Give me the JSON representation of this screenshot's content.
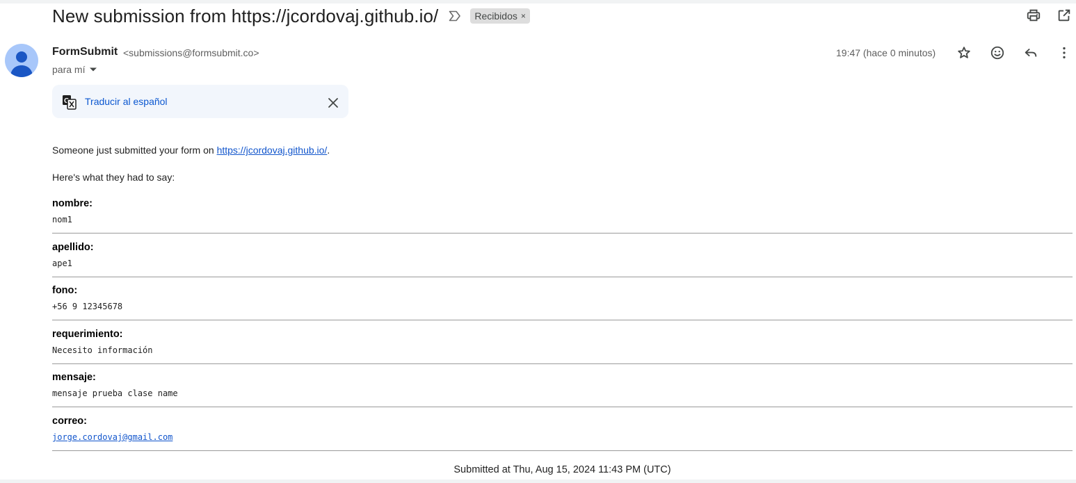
{
  "email": {
    "subject": "New submission from https://jcordovaj.github.io/",
    "label": "Recibidos",
    "label_remove": "×",
    "sender_name": "FormSubmit",
    "sender_email": "<submissions@formsubmit.co>",
    "recipient": "para mí",
    "timestamp": "19:47 (hace 0 minutos)"
  },
  "translate": {
    "link_text": "Traducir al español"
  },
  "body": {
    "intro_prefix": "Someone just submitted your form on ",
    "intro_link": "https://jcordovaj.github.io/",
    "intro_suffix": ".",
    "subheading": "Here's what they had to say:",
    "fields": [
      {
        "name": "nombre:",
        "value": "nom1"
      },
      {
        "name": "apellido:",
        "value": "ape1"
      },
      {
        "name": "fono:",
        "value": "+56 9 12345678"
      },
      {
        "name": "requerimiento:",
        "value": "Necesito información"
      },
      {
        "name": "mensaje:",
        "value": "mensaje prueba clase name"
      },
      {
        "name": "correo:",
        "value": "jorge.cordovaj@gmail.com"
      }
    ],
    "submitted_at": "Submitted at Thu, Aug 15, 2024 11:43 PM (UTC)"
  },
  "icons": {
    "important": "importance-marker-icon",
    "print": "print-icon",
    "open_new": "open-in-new-window-icon",
    "star": "star-icon",
    "emoji": "emoji-react-icon",
    "reply": "reply-icon",
    "more": "more-vert-icon",
    "translate": "translate-icon",
    "close": "close-icon",
    "caret": "caret-down-icon"
  },
  "colors": {
    "link": "#0b57d0",
    "avatar_bg": "#a8c7fa",
    "avatar_fg": "#1a56c4",
    "chip_bg": "#dddddd",
    "translate_bg": "#f2f6fc"
  }
}
